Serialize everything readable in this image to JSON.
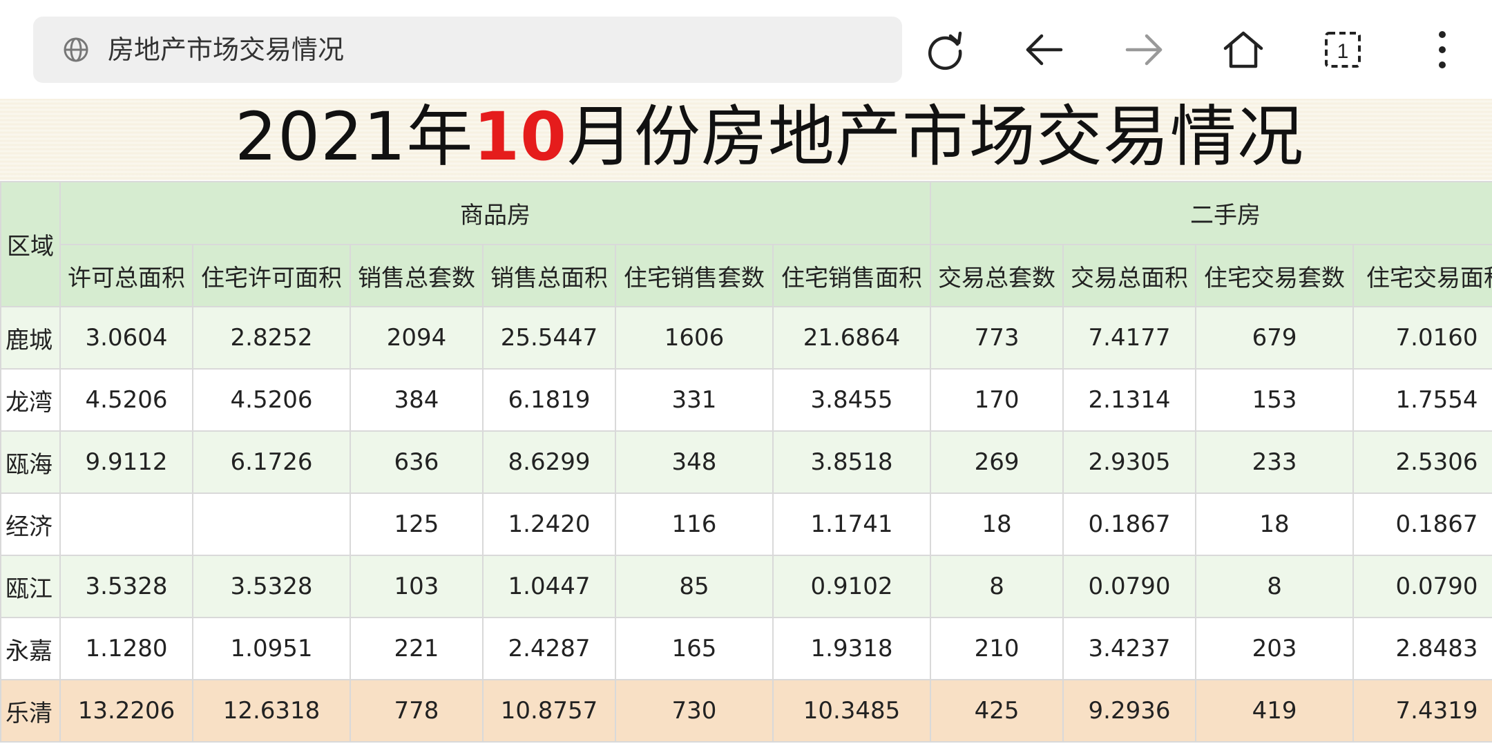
{
  "browser": {
    "url_text": "房地产市场交易情况",
    "icons": {
      "globe": "globe-icon",
      "reload": "reload-icon",
      "back": "arrow-left-icon",
      "forward": "arrow-right-icon",
      "home": "home-icon",
      "tabs": "tabs-icon",
      "menu": "more-vert-icon"
    },
    "tab_count": "1"
  },
  "page": {
    "title_prefix": "2021年",
    "title_highlight": "10",
    "title_suffix": "月份房地产市场交易情况",
    "highlight_color": "#e51c1c"
  },
  "table": {
    "region_header": "区域",
    "groups": [
      "商品房",
      "二手房"
    ],
    "columns": [
      "许可总面积",
      "住宅许可面积",
      "销售总套数",
      "销售总面积",
      "住宅销售套数",
      "住宅销售面积",
      "交易总套数",
      "交易总面积",
      "住宅交易套数",
      "住宅交易面积"
    ],
    "rows": [
      {
        "region": "鹿城",
        "values": [
          "3.0604",
          "2.8252",
          "2094",
          "25.5447",
          "1606",
          "21.6864",
          "773",
          "7.4177",
          "679",
          "7.0160"
        ]
      },
      {
        "region": "龙湾",
        "values": [
          "4.5206",
          "4.5206",
          "384",
          "6.1819",
          "331",
          "3.8455",
          "170",
          "2.1314",
          "153",
          "1.7554"
        ]
      },
      {
        "region": "瓯海",
        "values": [
          "9.9112",
          "6.1726",
          "636",
          "8.6299",
          "348",
          "3.8518",
          "269",
          "2.9305",
          "233",
          "2.5306"
        ]
      },
      {
        "region": "经济",
        "values": [
          "",
          "",
          "125",
          "1.2420",
          "116",
          "1.1741",
          "18",
          "0.1867",
          "18",
          "0.1867"
        ]
      },
      {
        "region": "瓯江",
        "values": [
          "3.5328",
          "3.5328",
          "103",
          "1.0447",
          "85",
          "0.9102",
          "8",
          "0.0790",
          "8",
          "0.0790"
        ]
      },
      {
        "region": "永嘉",
        "values": [
          "1.1280",
          "1.0951",
          "221",
          "2.4287",
          "165",
          "1.9318",
          "210",
          "3.4237",
          "203",
          "2.8483"
        ]
      },
      {
        "region": "乐清",
        "values": [
          "13.2206",
          "12.6318",
          "778",
          "10.8757",
          "730",
          "10.3485",
          "425",
          "9.2936",
          "419",
          "7.4319"
        ],
        "highlighted": true
      }
    ],
    "colors": {
      "header_bg": "#d6ecd0",
      "stripe_bg": "#eef7ea",
      "highlight_row_bg": "#f8e0c5"
    }
  }
}
